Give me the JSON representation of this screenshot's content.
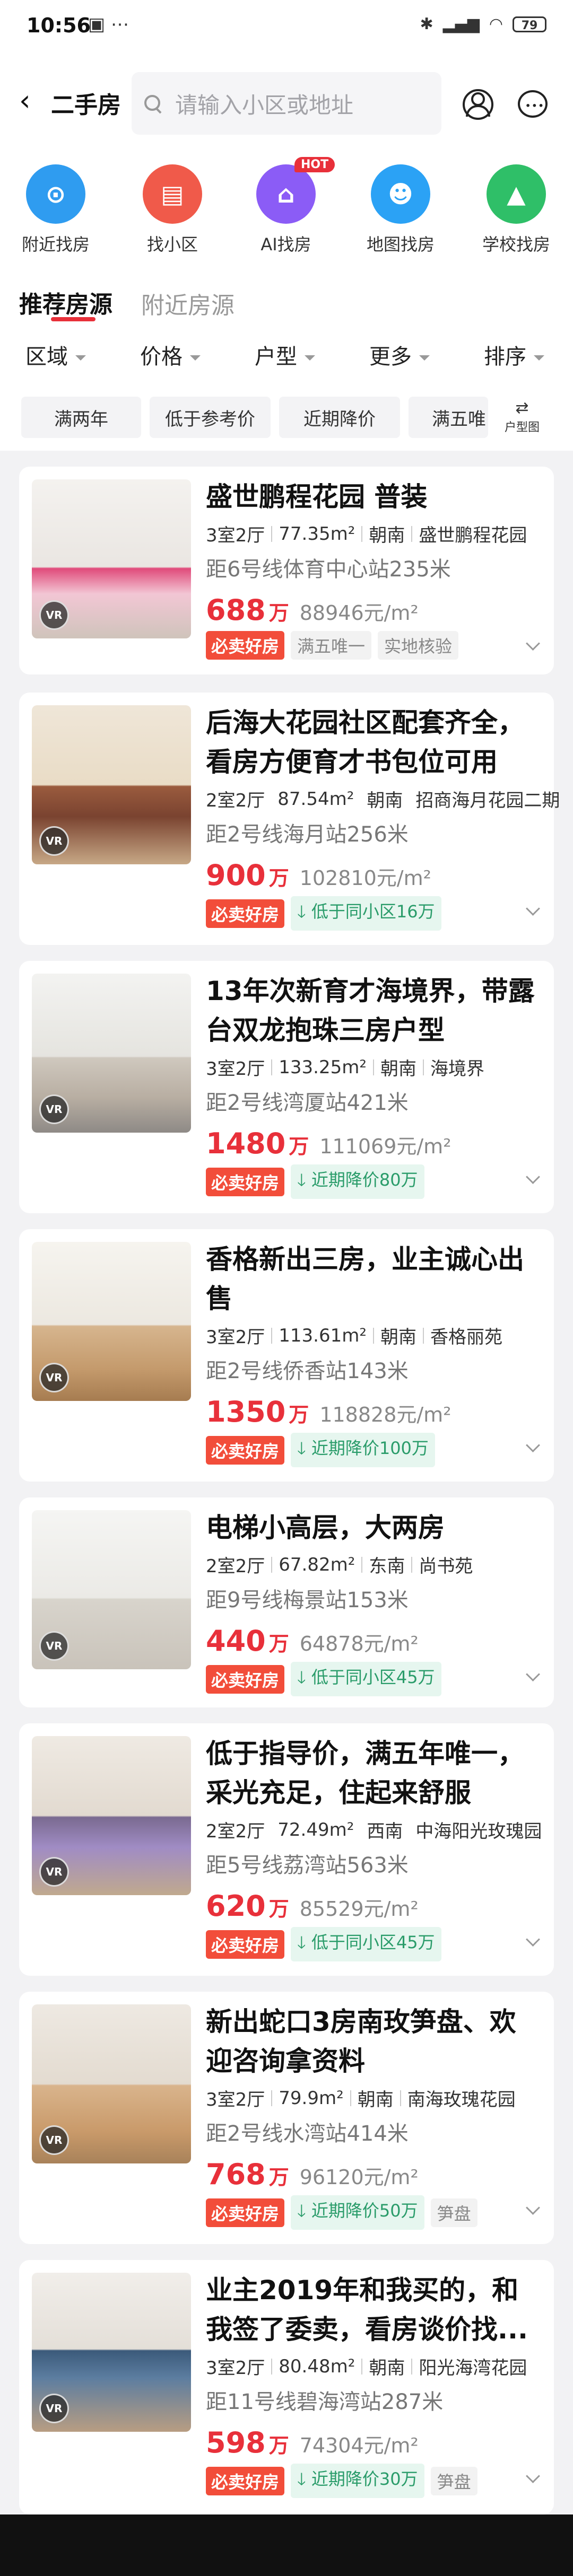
{
  "status_bar": {
    "time": "10:56",
    "battery": "79"
  },
  "header": {
    "back_icon": "chevron-left-icon",
    "title": "二手房",
    "search_placeholder": "请输入小区或地址"
  },
  "quick_entries": [
    {
      "label": "附近找房",
      "icon": "location-pin-icon",
      "color": "#2f9cf0"
    },
    {
      "label": "找小区",
      "icon": "building-icon",
      "color": "#f05a4a"
    },
    {
      "label": "AI找房",
      "icon": "ai-house-icon",
      "color": "#8b5cf6",
      "badge": "HOT"
    },
    {
      "label": "地图找房",
      "icon": "map-person-icon",
      "color": "#2ba2f5"
    },
    {
      "label": "学校找房",
      "icon": "school-cap-icon",
      "color": "#2fbf68"
    }
  ],
  "tabs": [
    {
      "label": "推荐房源"
    },
    {
      "label": "附近房源"
    }
  ],
  "filters": [
    {
      "label": "区域"
    },
    {
      "label": "价格"
    },
    {
      "label": "户型"
    },
    {
      "label": "更多"
    },
    {
      "label": "排序"
    }
  ],
  "chips": [
    {
      "label": "满两年"
    },
    {
      "label": "低于参考价"
    },
    {
      "label": "近期降价"
    },
    {
      "label": "满五唯"
    }
  ],
  "layout_toggle": {
    "label": "户型图"
  },
  "listings": [
    {
      "title": "盛世鹏程花园 普装",
      "rooms": "3室2厅",
      "area": "77.35m²",
      "orientation": "朝南",
      "community": "盛世鹏程花园",
      "metro": "距6号线体育中心站235米",
      "price": "688",
      "unit": "万",
      "unit_price": "88946元/m²",
      "tags": [
        "满五唯一",
        "实地核验"
      ],
      "green_tag": ""
    },
    {
      "title": "后海大花园社区配套齐全，看房方便育才书包位可用",
      "rooms": "2室2厅",
      "area": "87.54m²",
      "orientation": "朝南",
      "community": "招商海月花园二期",
      "metro": "距2号线海月站256米",
      "price": "900",
      "unit": "万",
      "unit_price": "102810元/m²",
      "tags": [],
      "green_tag": "低于同小区16万"
    },
    {
      "title": "13年次新育才海境界，带露台双龙抱珠三房户型",
      "rooms": "3室2厅",
      "area": "133.25m²",
      "orientation": "朝南",
      "community": "海境界",
      "metro": "距2号线湾厦站421米",
      "price": "1480",
      "unit": "万",
      "unit_price": "111069元/m²",
      "tags": [],
      "green_tag": "近期降价80万"
    },
    {
      "title": "香格新出三房，业主诚心出售",
      "rooms": "3室2厅",
      "area": "113.61m²",
      "orientation": "朝南",
      "community": "香格丽苑",
      "metro": "距2号线侨香站143米",
      "price": "1350",
      "unit": "万",
      "unit_price": "118828元/m²",
      "tags": [],
      "green_tag": "近期降价100万"
    },
    {
      "title": "电梯小高层，大两房",
      "rooms": "2室2厅",
      "area": "67.82m²",
      "orientation": "东南",
      "community": "尚书苑",
      "metro": "距9号线梅景站153米",
      "price": "440",
      "unit": "万",
      "unit_price": "64878元/m²",
      "tags": [],
      "green_tag": "低于同小区45万"
    },
    {
      "title": "低于指导价，满五年唯一，采光充足，住起来舒服",
      "rooms": "2室2厅",
      "area": "72.49m²",
      "orientation": "西南",
      "community": "中海阳光玫瑰园",
      "metro": "距5号线荔湾站563米",
      "price": "620",
      "unit": "万",
      "unit_price": "85529元/m²",
      "tags": [],
      "green_tag": "低于同小区45万"
    },
    {
      "title": "新出蛇口3房南玫笋盘、欢迎咨询拿资料",
      "rooms": "3室2厅",
      "area": "79.9m²",
      "orientation": "朝南",
      "community": "南海玫瑰花园",
      "metro": "距2号线水湾站414米",
      "price": "768",
      "unit": "万",
      "unit_price": "96120元/m²",
      "tags": [
        "笋盘"
      ],
      "green_tag": "近期降价50万"
    },
    {
      "title": "业主2019年和我买的，和我签了委卖，看房谈价找...",
      "rooms": "3室2厅",
      "area": "80.48m²",
      "orientation": "朝南",
      "community": "阳光海湾花园",
      "metro": "距11号线碧海湾站287米",
      "price": "598",
      "unit": "万",
      "unit_price": "74304元/m²",
      "tags": [
        "笋盘"
      ],
      "green_tag": "近期降价30万"
    }
  ],
  "labels": {
    "hot_tag": "必卖好房",
    "vr": "VR"
  },
  "colors": {
    "accent": "#e8303a",
    "green": "#2a9c6a"
  }
}
